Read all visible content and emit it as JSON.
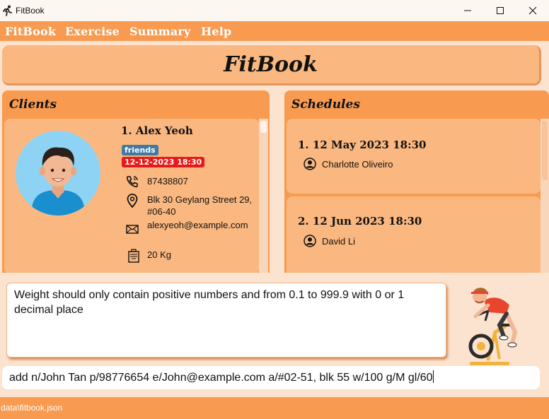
{
  "window": {
    "title": "FitBook"
  },
  "menu": {
    "items": [
      "FitBook",
      "Exercise",
      "Summary",
      "Help"
    ]
  },
  "header": {
    "title": "FitBook"
  },
  "clients": {
    "title": "Clients",
    "list": [
      {
        "index": "1.",
        "name": "Alex Yeoh",
        "index_name": "1.  Alex Yeoh",
        "tags": [
          "friends",
          "12-12-2023 18:30"
        ],
        "phone": "87438807",
        "address": "Blk 30 Geylang Street 29, #06-40",
        "email": "alexyeoh@example.com",
        "weight": "20 Kg"
      }
    ]
  },
  "schedules": {
    "title": "Schedules",
    "list": [
      {
        "index_date": "1.  12 May 2023 18:30",
        "client": "Charlotte Oliveiro"
      },
      {
        "index_date": "2.  12 Jun 2023 18:30",
        "client": "David Li"
      }
    ]
  },
  "result": {
    "text": "Weight should only contain positive numbers and from 0.1 to 999.9 with 0 or 1 decimal place"
  },
  "command": {
    "value": "add n/John Tan p/98776654 e/John@example.com a/#02-51, blk 55 w/100 g/M gl/60"
  },
  "status": {
    "path": "data\\fitbook.json"
  },
  "colors": {
    "menu_bg": "#f89a4f",
    "card_bg": "#fab880",
    "page_bg": "#fbe3cf",
    "tag_blue": "#3e7aa3",
    "tag_red": "#e81919"
  }
}
